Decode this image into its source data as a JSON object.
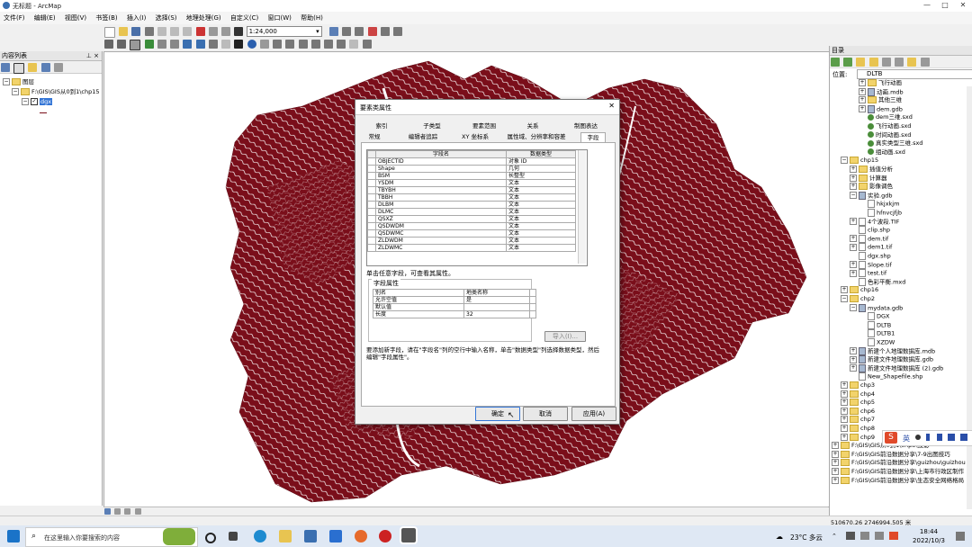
{
  "window": {
    "title": "无标题 - ArcMap",
    "minimize": "—",
    "maximize": "□",
    "close": "✕"
  },
  "menu": [
    "文件(F)",
    "编辑(E)",
    "视图(V)",
    "书签(B)",
    "插入(I)",
    "选择(S)",
    "地理处理(G)",
    "自定义(C)",
    "窗口(W)",
    "帮助(H)"
  ],
  "toolbar": {
    "scale": "1:24,000"
  },
  "toc": {
    "title": "内容列表",
    "pin": "⊥ ×",
    "root": "图层",
    "path": "F:\\GIS\\GIS从0到1\\chp15",
    "layer": "dgx"
  },
  "catalog": {
    "title": "目录",
    "location_label": "位置:",
    "location_value": "DLTB",
    "items": [
      {
        "label": "飞行动画",
        "indent": 3,
        "icon": "fold",
        "exp": "+"
      },
      {
        "label": "动画.mdb",
        "indent": 3,
        "icon": "db",
        "exp": "+"
      },
      {
        "label": "其他三维",
        "indent": 3,
        "icon": "fold",
        "exp": "+"
      },
      {
        "label": "dem.gdb",
        "indent": 3,
        "icon": "db",
        "exp": "+"
      },
      {
        "label": "dem三维.sxd",
        "indent": 3,
        "icon": "globe",
        "exp": ""
      },
      {
        "label": "飞行动画.sxd",
        "indent": 3,
        "icon": "globe",
        "exp": ""
      },
      {
        "label": "时间动画.sxd",
        "indent": 3,
        "icon": "globe",
        "exp": ""
      },
      {
        "label": "真实类型三维.sxd",
        "indent": 3,
        "icon": "globe",
        "exp": ""
      },
      {
        "label": "组动画.sxd",
        "indent": 3,
        "icon": "globe",
        "exp": ""
      },
      {
        "label": "chp15",
        "indent": 1,
        "icon": "fold",
        "exp": "−"
      },
      {
        "label": "插值分析",
        "indent": 2,
        "icon": "fold",
        "exp": "+"
      },
      {
        "label": "计算器",
        "indent": 2,
        "icon": "fold",
        "exp": "+"
      },
      {
        "label": "影像调色",
        "indent": 2,
        "icon": "fold",
        "exp": "+"
      },
      {
        "label": "实验.gdb",
        "indent": 2,
        "icon": "db",
        "exp": "−"
      },
      {
        "label": "hkjxkjm",
        "indent": 3,
        "icon": "file",
        "exp": ""
      },
      {
        "label": "hfnvcjfjb",
        "indent": 3,
        "icon": "file",
        "exp": ""
      },
      {
        "label": "4个波段.TIF",
        "indent": 2,
        "icon": "file",
        "exp": "+"
      },
      {
        "label": "clip.shp",
        "indent": 2,
        "icon": "file",
        "exp": ""
      },
      {
        "label": "dem.tif",
        "indent": 2,
        "icon": "file",
        "exp": "+"
      },
      {
        "label": "dem1.tif",
        "indent": 2,
        "icon": "file",
        "exp": "+"
      },
      {
        "label": "dgx.shp",
        "indent": 2,
        "icon": "file",
        "exp": ""
      },
      {
        "label": "Slope.tif",
        "indent": 2,
        "icon": "file",
        "exp": "+"
      },
      {
        "label": "test.tif",
        "indent": 2,
        "icon": "file",
        "exp": "+"
      },
      {
        "label": "色彩平衡.mxd",
        "indent": 2,
        "icon": "file",
        "exp": ""
      },
      {
        "label": "chp16",
        "indent": 1,
        "icon": "fold",
        "exp": "+"
      },
      {
        "label": "chp2",
        "indent": 1,
        "icon": "fold",
        "exp": "−"
      },
      {
        "label": "mydata.gdb",
        "indent": 2,
        "icon": "db",
        "exp": "−"
      },
      {
        "label": "DGX",
        "indent": 3,
        "icon": "file",
        "exp": ""
      },
      {
        "label": "DLTB",
        "indent": 3,
        "icon": "file",
        "exp": ""
      },
      {
        "label": "DLTB1",
        "indent": 3,
        "icon": "file",
        "exp": ""
      },
      {
        "label": "XZDW",
        "indent": 3,
        "icon": "file",
        "exp": ""
      },
      {
        "label": "新建个人地理数据库.mdb",
        "indent": 2,
        "icon": "db",
        "exp": "+"
      },
      {
        "label": "新建文件地理数据库.gdb",
        "indent": 2,
        "icon": "db",
        "exp": "+"
      },
      {
        "label": "新建文件地理数据库 (2).gdb",
        "indent": 2,
        "icon": "db",
        "exp": "+"
      },
      {
        "label": "New_Shapefile.shp",
        "indent": 2,
        "icon": "file",
        "exp": ""
      },
      {
        "label": "chp3",
        "indent": 1,
        "icon": "fold",
        "exp": "+"
      },
      {
        "label": "chp4",
        "indent": 1,
        "icon": "fold",
        "exp": "+"
      },
      {
        "label": "chp5",
        "indent": 1,
        "icon": "fold",
        "exp": "+"
      },
      {
        "label": "chp6",
        "indent": 1,
        "icon": "fold",
        "exp": "+"
      },
      {
        "label": "chp7",
        "indent": 1,
        "icon": "fold",
        "exp": "+"
      },
      {
        "label": "chp8",
        "indent": 1,
        "icon": "fold",
        "exp": "+"
      },
      {
        "label": "chp9",
        "indent": 1,
        "icon": "fold",
        "exp": "+"
      },
      {
        "label": "F:\\GIS\\GIS从0到1\\chp3\\投影",
        "indent": 0,
        "icon": "fold",
        "exp": "+"
      },
      {
        "label": "F:\\GIS\\GIS前沿数据分享\\7-9出图技巧",
        "indent": 0,
        "icon": "fold",
        "exp": "+"
      },
      {
        "label": "F:\\GIS\\GIS前沿数据分享\\guizhou\\guizhou",
        "indent": 0,
        "icon": "fold",
        "exp": "+"
      },
      {
        "label": "F:\\GIS\\GIS前沿数据分享\\上海市行政区制作",
        "indent": 0,
        "icon": "fold",
        "exp": "+"
      },
      {
        "label": "F:\\GIS\\GIS前沿数据分享\\生态安全网络格局",
        "indent": 0,
        "icon": "fold",
        "exp": "+"
      }
    ]
  },
  "dialog": {
    "title": "要素类属性",
    "close": "✕",
    "tabs_row1": [
      "索引",
      "子类型",
      "要素范围",
      "关系",
      "制图表达"
    ],
    "tabs_row2": [
      "常规",
      "编辑者追踪",
      "XY 坐标系",
      "属性域、分辨率和容差",
      "字段"
    ],
    "col_field": "字段名",
    "col_type": "数据类型",
    "fields": [
      {
        "name": "OBJECTID",
        "type": "对象 ID"
      },
      {
        "name": "Shape",
        "type": "几何"
      },
      {
        "name": "BSM",
        "type": "长整型"
      },
      {
        "name": "YSDM",
        "type": "文本"
      },
      {
        "name": "TBYBH",
        "type": "文本"
      },
      {
        "name": "TBBH",
        "type": "文本"
      },
      {
        "name": "DLBM",
        "type": "文本"
      },
      {
        "name": "DLMC",
        "type": "文本"
      },
      {
        "name": "QSXZ",
        "type": "文本"
      },
      {
        "name": "QSDWDM",
        "type": "文本"
      },
      {
        "name": "QSDWMC",
        "type": "文本"
      },
      {
        "name": "ZLDWDM",
        "type": "文本"
      },
      {
        "name": "ZLDWMC",
        "type": "文本"
      }
    ],
    "hint": "单击任意字段，可查看其属性。",
    "props_title": "字段属性",
    "props": [
      {
        "k": "别名",
        "v": "地类名称"
      },
      {
        "k": "允许空值",
        "v": "是"
      },
      {
        "k": "默认值",
        "v": ""
      },
      {
        "k": "长度",
        "v": "32"
      }
    ],
    "import_btn": "导入(I)...",
    "note": "要添加新字段，请在\"字段名\"列的空行中输入名称，单击\"数据类型\"列选择数据类型，然后编辑\"字段属性\"。",
    "ok": "确定",
    "cancel": "取消",
    "apply": "应用(A)"
  },
  "status": {
    "coords": "510670.26  2746994.505 米"
  },
  "taskbar": {
    "search_placeholder": "在这里输入你要搜索的内容",
    "weather": "23°C 多云",
    "time": "18:44",
    "date": "2022/10/3",
    "ime": "英"
  },
  "colors": {
    "map_fill": "#7a0e1a",
    "dialog_bg": "#f0f0f0",
    "selection": "#3375d6"
  }
}
